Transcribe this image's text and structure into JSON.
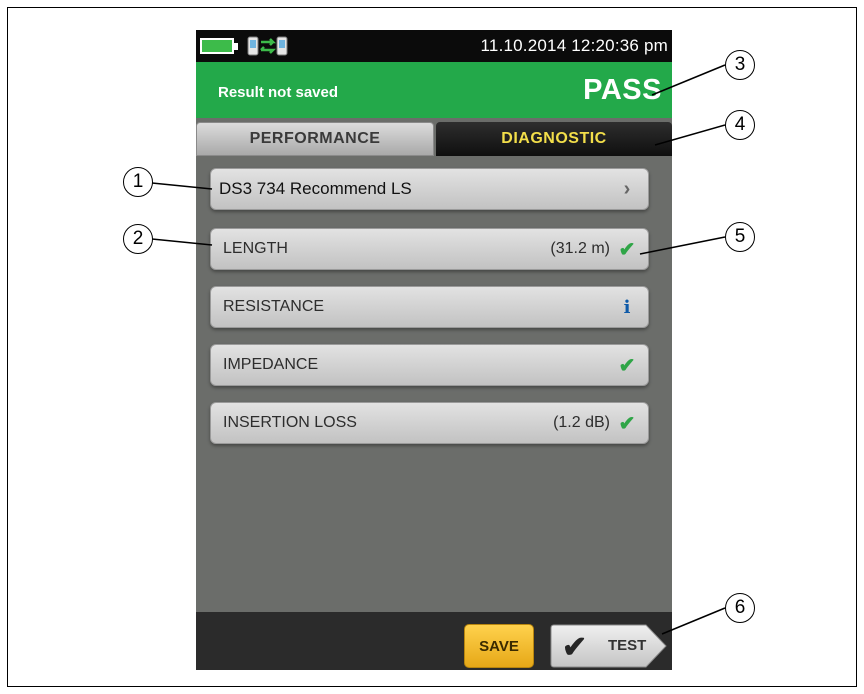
{
  "statusbar": {
    "datetime": "11.10.2014 12:20:36 pm",
    "battery_icon": "battery-icon",
    "link_icon": "link-status-icon"
  },
  "header": {
    "save_status": "Result not saved",
    "result": "PASS",
    "color": "#23a94a"
  },
  "tabs": [
    {
      "label": "PERFORMANCE",
      "active": false
    },
    {
      "label": "DIAGNOSTIC",
      "active": true
    }
  ],
  "limit_row": {
    "label": "DS3 734 Recommend LS",
    "icon": "chevron-right-icon"
  },
  "results": [
    {
      "label": "LENGTH",
      "value": "(31.2 m)",
      "icon": "check-icon"
    },
    {
      "label": "RESISTANCE",
      "value": "",
      "icon": "info-icon"
    },
    {
      "label": "IMPEDANCE",
      "value": "",
      "icon": "check-icon"
    },
    {
      "label": "INSERTION LOSS",
      "value": "(1.2 dB)",
      "icon": "check-icon"
    }
  ],
  "buttons": {
    "save_label": "SAVE",
    "test_label": "TEST"
  },
  "callouts": [
    "1",
    "2",
    "3",
    "4",
    "5",
    "6"
  ]
}
